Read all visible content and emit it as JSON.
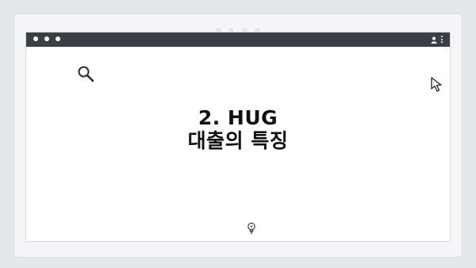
{
  "slide": {
    "title_line1": "2. HUG",
    "title_line2": "대출의 특징"
  },
  "icons": {
    "search": "search-icon",
    "cursor": "cursor-icon",
    "lightbulb": "lightbulb-icon",
    "user": "user-icon",
    "menu": "kebab-menu-icon"
  },
  "colors": {
    "titlebar": "#3a3f45",
    "background": "#e4e8ec",
    "text": "#111111"
  }
}
